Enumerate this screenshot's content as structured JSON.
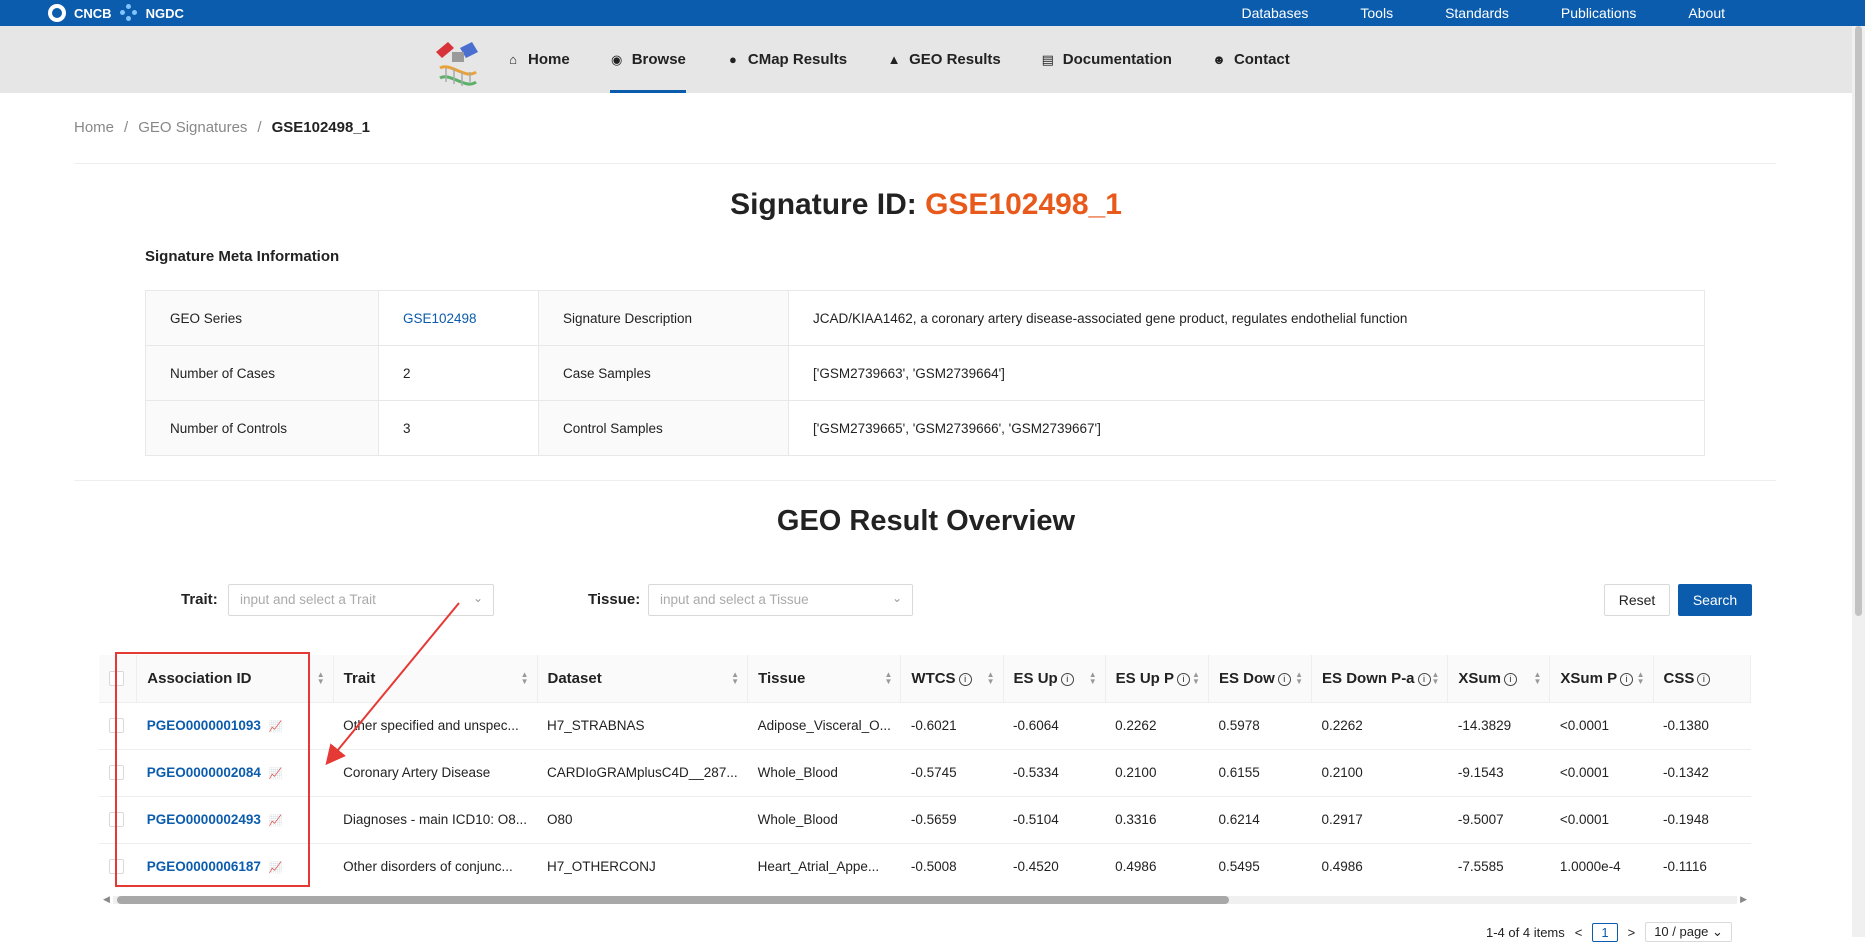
{
  "topbar": {
    "brand_left": "CNCB",
    "brand_right": "NGDC",
    "links": [
      "Databases",
      "Tools",
      "Standards",
      "Publications",
      "About"
    ]
  },
  "nav": {
    "items": [
      {
        "label": "Home",
        "icon": "home-icon"
      },
      {
        "label": "Browse",
        "icon": "eye-icon"
      },
      {
        "label": "CMap Results",
        "icon": "binoculars-icon"
      },
      {
        "label": "GEO Results",
        "icon": "mountain-icon"
      },
      {
        "label": "Documentation",
        "icon": "document-icon"
      },
      {
        "label": "Contact",
        "icon": "contact-icon"
      }
    ],
    "active": "Browse"
  },
  "breadcrumb": {
    "items": [
      "Home",
      "GEO Signatures",
      "GSE102498_1"
    ],
    "separator": "/"
  },
  "signature": {
    "title_prefix": "Signature ID: ",
    "id": "GSE102498_1",
    "meta_heading": "Signature Meta Information"
  },
  "meta": {
    "rows": [
      {
        "l1": "GEO Series",
        "v1": "GSE102498",
        "l2": "Signature Description",
        "v2": "JCAD/KIAA1462, a coronary artery disease-associated gene product, regulates endothelial function"
      },
      {
        "l1": "Number of Cases",
        "v1": "2",
        "l2": "Case Samples",
        "v2": "['GSM2739663', 'GSM2739664']"
      },
      {
        "l1": "Number of Controls",
        "v1": "3",
        "l2": "Control Samples",
        "v2": "['GSM2739665', 'GSM2739666', 'GSM2739667']"
      }
    ]
  },
  "overview": {
    "title": "GEO Result Overview",
    "trait_label": "Trait",
    "trait_placeholder": "input and select a Trait",
    "tissue_label": "Tissue",
    "tissue_placeholder": "input and select a Tissue",
    "reset": "Reset",
    "search": "Search"
  },
  "results": {
    "columns": [
      "Association ID",
      "Trait",
      "Dataset",
      "Tissue",
      "WTCS",
      "ES Up",
      "ES Up P",
      "ES Dow",
      "ES Down P-a",
      "XSum",
      "XSum P",
      "CSS"
    ],
    "rows": [
      [
        "PGEO0000001093",
        "Other specified and unspec...",
        "H7_STRABNAS",
        "Adipose_Visceral_O...",
        "-0.6021",
        "-0.6064",
        "0.2262",
        "0.5978",
        "0.2262",
        "-14.3829",
        "<0.0001",
        "-0.1380"
      ],
      [
        "PGEO0000002084",
        "Coronary Artery Disease",
        "CARDIoGRAMplusC4D__287...",
        "Whole_Blood",
        "-0.5745",
        "-0.5334",
        "0.2100",
        "0.6155",
        "0.2100",
        "-9.1543",
        "<0.0001",
        "-0.1342"
      ],
      [
        "PGEO0000002493",
        "Diagnoses - main ICD10: O8...",
        "O80",
        "Whole_Blood",
        "-0.5659",
        "-0.5104",
        "0.3316",
        "0.6214",
        "0.2917",
        "-9.5007",
        "<0.0001",
        "-0.1948"
      ],
      [
        "PGEO0000006187",
        "Other disorders of conjunc...",
        "H7_OTHERCONJ",
        "Heart_Atrial_Appe...",
        "-0.5008",
        "-0.4520",
        "0.4986",
        "0.5495",
        "0.4986",
        "-7.5585",
        "1.0000e-4",
        "-0.1116"
      ]
    ]
  },
  "pagination": {
    "summary": "1-4 of 4 items",
    "current_page": "1",
    "page_size": "10 / page"
  }
}
